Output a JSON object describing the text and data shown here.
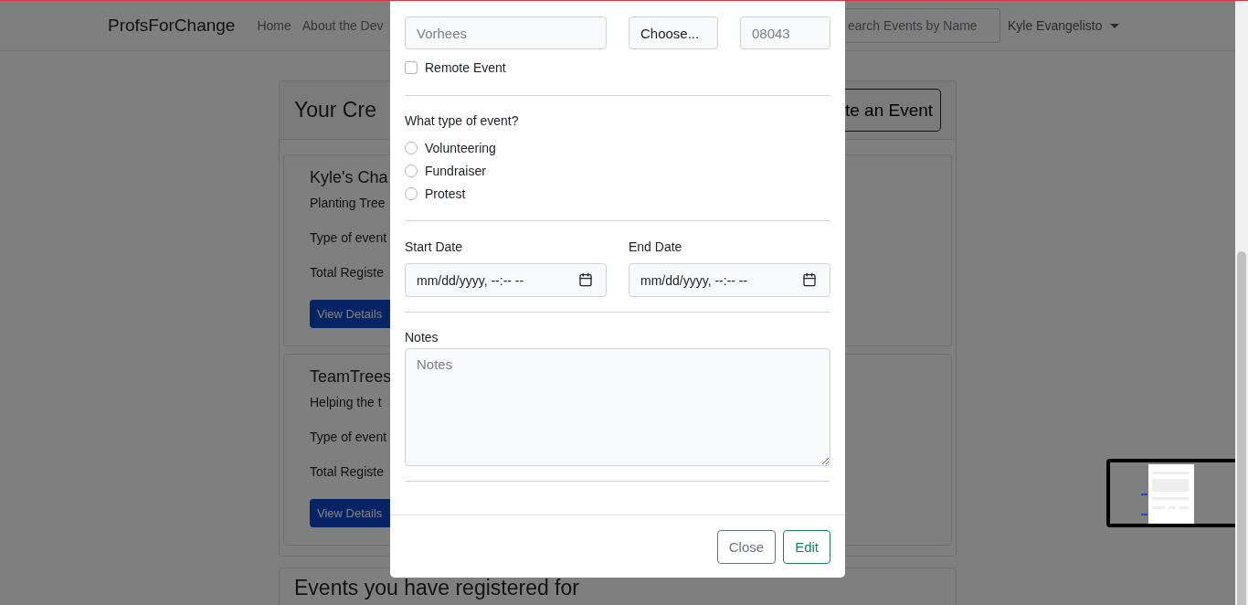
{
  "navbar": {
    "brand": "ProfsForChange",
    "links": [
      "Home",
      "About the Dev"
    ],
    "search": {
      "placeholder": "earch Events by Name"
    },
    "user_menu": "Kyle Evangelisto"
  },
  "created_events": {
    "title": "Your Cre",
    "create_button": "te an Event",
    "cards": [
      {
        "title": "Kyle's Cha",
        "description": "Planting Tree",
        "type_label": "Type of event",
        "registered_label": "Total Registe",
        "button": "View Details"
      },
      {
        "title": "TeamTrees",
        "description": "Helping the t",
        "type_label": "Type of event",
        "registered_label": "Total Registe",
        "button": "View Details"
      }
    ]
  },
  "registered_events": {
    "title": "Events you have registered for"
  },
  "modal": {
    "city": {
      "placeholder": "Vorhees"
    },
    "state": {
      "value": "Choose..."
    },
    "zipcode": {
      "placeholder": "08043"
    },
    "remote": {
      "label": "Remote Event",
      "checked": false
    },
    "event_type": {
      "question": "What type of event?",
      "options": [
        {
          "label": "Volunteering",
          "selected": false
        },
        {
          "label": "Fundraiser",
          "selected": false
        },
        {
          "label": "Protest",
          "selected": false
        }
      ]
    },
    "start_date": {
      "label": "Start Date",
      "placeholder": "mm/dd/yyyy, --:-- --"
    },
    "end_date": {
      "label": "End Date",
      "placeholder": "mm/dd/yyyy, --:-- --"
    },
    "notes": {
      "label": "Notes",
      "placeholder": "Notes"
    },
    "buttons": {
      "close": "Close",
      "edit": "Edit"
    }
  }
}
